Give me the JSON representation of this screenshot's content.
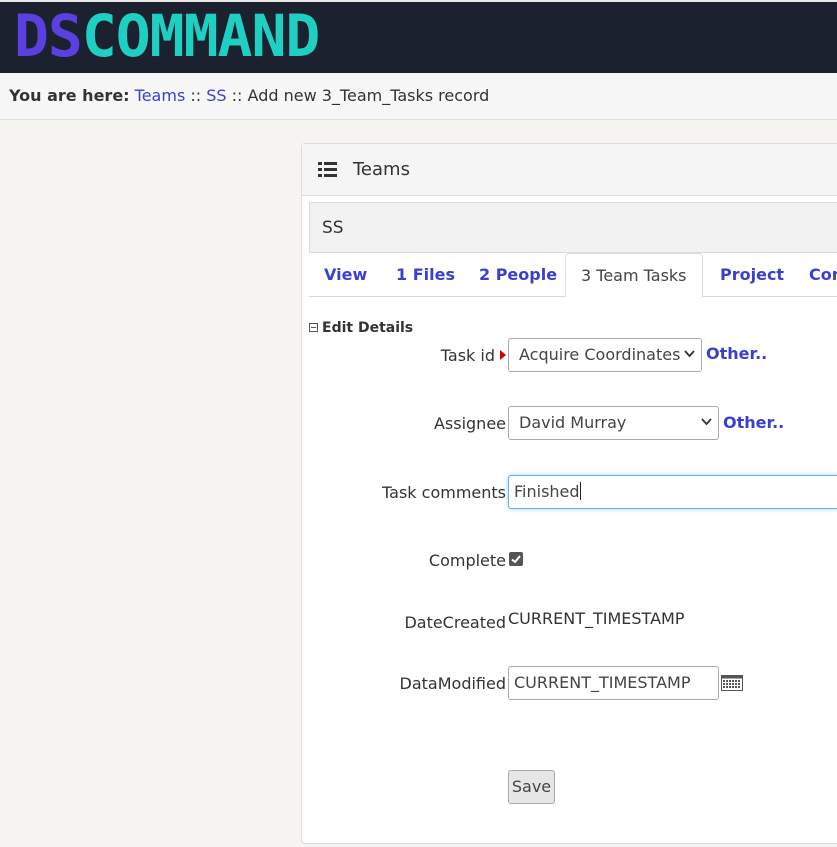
{
  "logo": {
    "part1": "DS",
    "part2": "COMMAND"
  },
  "breadcrumb": {
    "label": "You are here:",
    "items": [
      "Teams",
      "SS"
    ],
    "sep": "::",
    "current": "Add new 3_Team_Tasks record"
  },
  "panel": {
    "title": "Teams",
    "icon": "list-icon"
  },
  "record": {
    "title": "SS"
  },
  "tabs": [
    "View",
    "1 Files",
    "2 People",
    "3 Team Tasks",
    "Project",
    "Con"
  ],
  "active_tab": "3 Team Tasks",
  "form": {
    "legend": "Edit Details",
    "fields": {
      "task_id": {
        "label": "Task id",
        "value": "Acquire Coordinates",
        "other": "Other.."
      },
      "assignee": {
        "label": "Assignee",
        "value": "David Murray",
        "other": "Other.."
      },
      "task_comments": {
        "label": "Task comments",
        "value": "Finished"
      },
      "complete": {
        "label": "Complete",
        "checked": true
      },
      "date_created": {
        "label": "DateCreated",
        "value": "CURRENT_TIMESTAMP"
      },
      "data_modified": {
        "label": "DataModified",
        "value": "CURRENT_TIMESTAMP"
      }
    },
    "save_label": "Save"
  },
  "colors": {
    "header_bg": "#1c2130",
    "logo_purple": "#5b3fe0",
    "logo_teal": "#1ed0c2",
    "link": "#3a3fd0"
  }
}
